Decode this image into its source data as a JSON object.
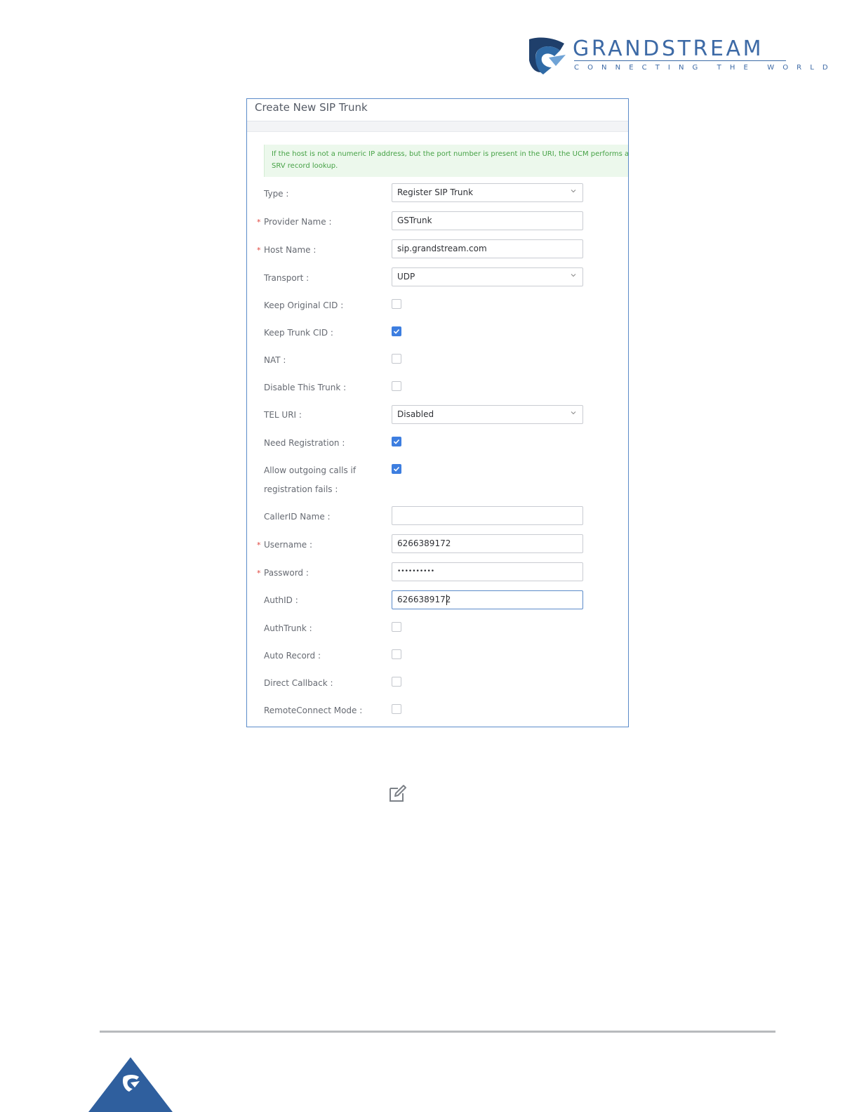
{
  "brand": {
    "name": "GRANDSTREAM",
    "tagline": "CONNECTING THE WORLD",
    "color": "#3d6aa6"
  },
  "dialog": {
    "title": "Create New SIP Trunk",
    "notice_line1": "If the host is not a numeric IP address, but the port number is present in the URI, the UCM performs an A or AAAA record lookup.",
    "notice_line2": "SRV record lookup.",
    "fields": {
      "type": {
        "label": "Type :",
        "value": "Register SIP Trunk",
        "icon": "chevron-down-icon"
      },
      "provider_name": {
        "label": "Provider Name :",
        "value": "GSTrunk",
        "required_mark": "*"
      },
      "host_name": {
        "label": "Host Name :",
        "value": "sip.grandstream.com",
        "required_mark": "*"
      },
      "transport": {
        "label": "Transport :",
        "value": "UDP",
        "icon": "chevron-down-icon"
      },
      "keep_original_cid": {
        "label": "Keep Original CID :",
        "checked": false
      },
      "keep_trunk_cid": {
        "label": "Keep Trunk CID :",
        "checked": true
      },
      "nat": {
        "label": "NAT :",
        "checked": false
      },
      "disable_this_trunk": {
        "label": "Disable This Trunk :",
        "checked": false
      },
      "tel_uri": {
        "label": "TEL URI :",
        "value": "Disabled",
        "icon": "chevron-down-icon"
      },
      "need_registration": {
        "label": "Need Registration :",
        "checked": true
      },
      "allow_outgoing": {
        "label_line1": "Allow outgoing calls if",
        "label_line2": "registration fails :",
        "checked": true
      },
      "callerid_name": {
        "label": "CallerID Name :",
        "value": ""
      },
      "username": {
        "label": "Username :",
        "value": "6266389172",
        "required_mark": "*"
      },
      "password": {
        "label": "Password :",
        "value": "••••••••••",
        "required_mark": "*"
      },
      "authid": {
        "label": "AuthID :",
        "value": "6266389172"
      },
      "authtrunk": {
        "label": "AuthTrunk :",
        "checked": false
      },
      "auto_record": {
        "label": "Auto Record :",
        "checked": false
      },
      "direct_callback": {
        "label": "Direct Callback :",
        "checked": false
      },
      "remoteconnect_mode": {
        "label": "RemoteConnect Mode :",
        "checked": false
      }
    }
  },
  "icons": {
    "edit": "edit-icon",
    "footer": "grandstream-badge-icon"
  },
  "colors": {
    "accent": "#3d7ee0",
    "required": "#e0443c",
    "notice_text": "#46a246",
    "notice_bg": "#ecf8ec"
  }
}
